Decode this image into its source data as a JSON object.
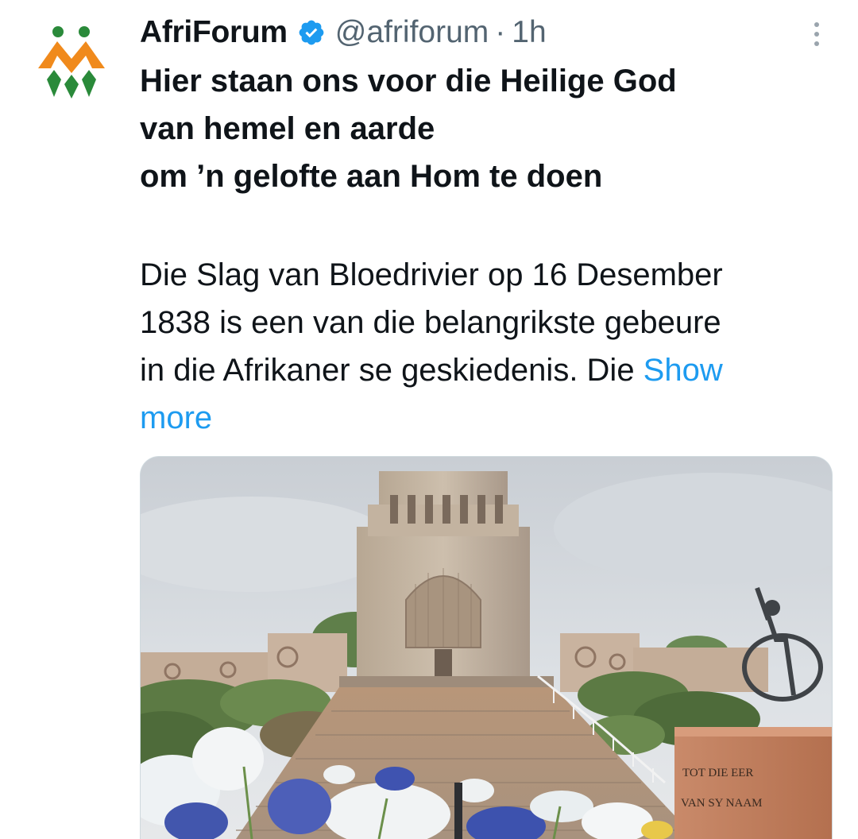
{
  "tweet": {
    "author_name": "AfriForum",
    "handle": "@afriforum",
    "separator": "·",
    "time": "1h",
    "headline_lines": [
      "Hier staan ons voor die Heilige God",
      "van hemel en aarde",
      "om ’n gelofte aan Hom te doen"
    ],
    "body_lines": [
      "Die Slag van Bloedrivier op 16 Desember",
      "1838 is een van die belangrikste gebeure"
    ],
    "body_line3": "in die Afrikaner se geskiedenis. Die ",
    "show_more_1": "Show",
    "show_more_2": "more",
    "media": {
      "inscription_line1": "TOT DIE EER",
      "inscription_line2": "VAN SY NAAM"
    }
  },
  "icons": {
    "avatar": "afriforum-logo-icon",
    "verified": "verified-badge-icon",
    "more": "more-vertical-icon"
  },
  "colors": {
    "accent": "#1d9bf0",
    "secondary_text": "#536471",
    "logo_green": "#2a8a3a",
    "logo_orange": "#f08a1c"
  }
}
